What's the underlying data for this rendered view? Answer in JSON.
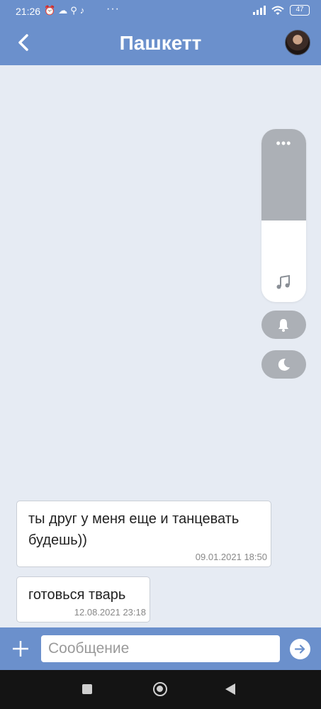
{
  "status_bar": {
    "time": "21:26",
    "icons": [
      "alarm-icon",
      "cloud-icon",
      "search-icon",
      "tiktok-icon"
    ],
    "more": "···",
    "battery": "47"
  },
  "header": {
    "title": "Пашкетт",
    "back_icon": "chevron-left-icon",
    "avatar": "contact-avatar"
  },
  "volume_panel": {
    "more": "•••",
    "level": 0.47,
    "icon": "music-note-icon",
    "buttons": [
      "bell-icon",
      "moon-icon"
    ]
  },
  "messages": [
    {
      "text": "ты друг у меня еще и танцевать будешь))",
      "timestamp": "09.01.2021 18:50"
    },
    {
      "text": "готовься тварь",
      "timestamp": "12.08.2021 23:18"
    }
  ],
  "input_bar": {
    "placeholder": "Сообщение",
    "value": "",
    "attach_icon": "plus-icon",
    "send_icon": "arrow-right-icon"
  },
  "colors": {
    "accent": "#6b90cc",
    "background": "#e6ebf3",
    "volume_track": "#acb0b6"
  }
}
